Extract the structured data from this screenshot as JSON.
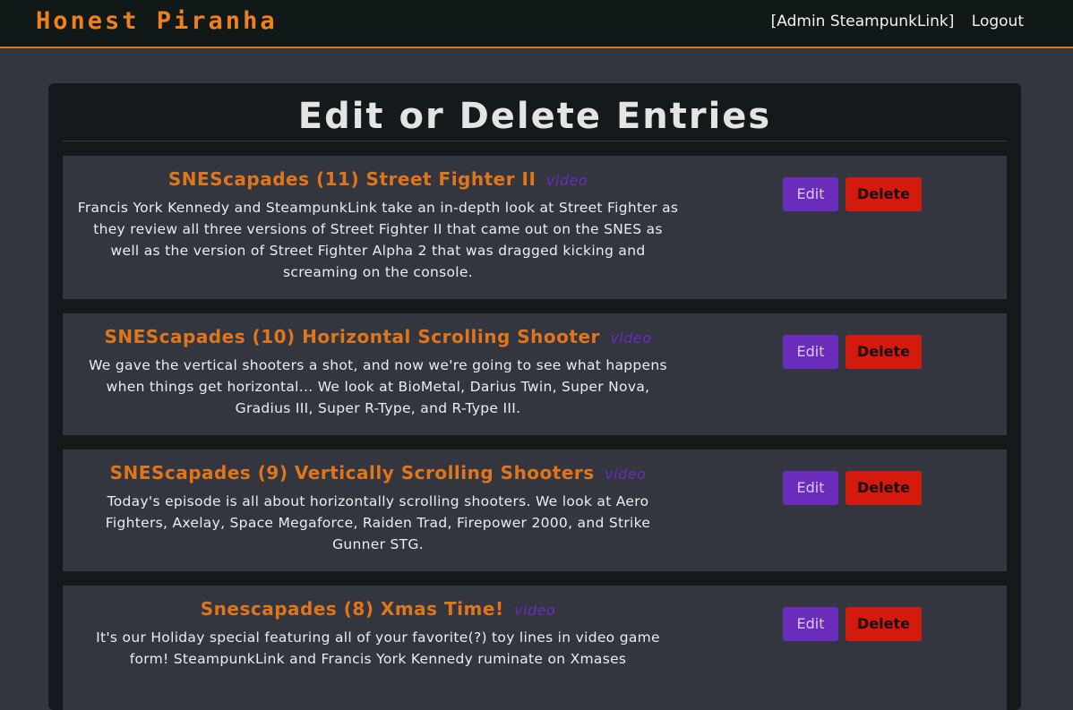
{
  "nav": {
    "brand": "Honest Piranha",
    "user_label": "[Admin SteampunkLink]",
    "logout_label": "Logout"
  },
  "page": {
    "title": "Edit or Delete Entries"
  },
  "entries": [
    {
      "title": "SNEScapades (11) Street Fighter II",
      "link_label": "video",
      "description": "Francis York Kennedy and SteampunkLink take an in-depth look at Street Fighter as they review all three versions of Street Fighter II that came out on the SNES as well as the version of Street Fighter Alpha 2 that was dragged kicking and screaming on the console.",
      "edit_label": "Edit",
      "delete_label": "Delete"
    },
    {
      "title": "SNEScapades (10) Horizontal Scrolling Shooter",
      "link_label": "video",
      "description": "We gave the vertical shooters a shot, and now we're going to see what happens when things get horizontal... We look at BioMetal, Darius Twin, Super Nova, Gradius III, Super R-Type, and R-Type III.",
      "edit_label": "Edit",
      "delete_label": "Delete"
    },
    {
      "title": "SNEScapades (9) Vertically Scrolling Shooters",
      "link_label": "video",
      "description": "Today's episode is all about horizontally scrolling shooters. We look at Aero Fighters, Axelay, Space Megaforce, Raiden Trad, Firepower 2000, and Strike Gunner STG.",
      "edit_label": "Edit",
      "delete_label": "Delete"
    },
    {
      "title": "Snescapades (8) Xmas Time!",
      "link_label": "video",
      "description": "It's our Holiday special featuring all of your favorite(?) toy lines in video game form! SteampunkLink and Francis York Kennedy ruminate on Xmases",
      "edit_label": "Edit",
      "delete_label": "Delete"
    }
  ],
  "colors": {
    "accent": "#e0761c",
    "edit_button": "#6a2cba",
    "delete_button": "#d41a0c",
    "page_bg": "#33363e",
    "panel_bg": "#141a1b"
  }
}
